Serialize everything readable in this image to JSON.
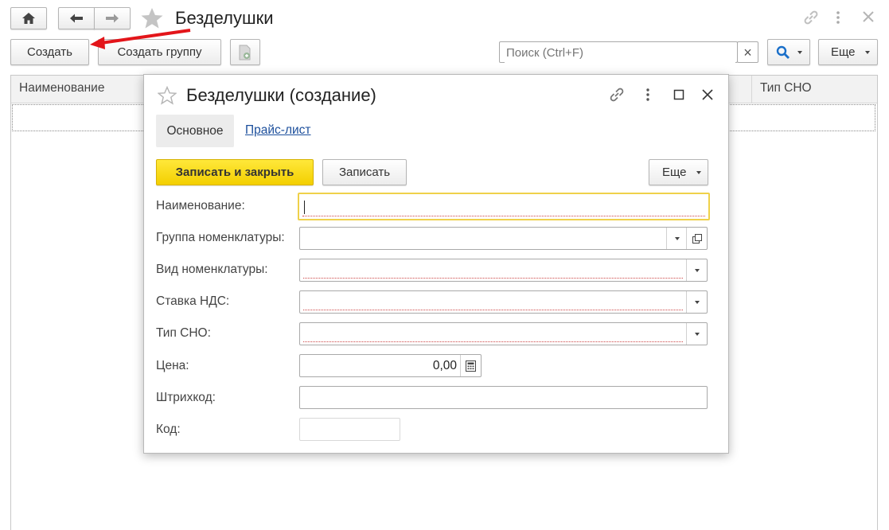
{
  "header": {
    "title": "Безделушки"
  },
  "toolbar": {
    "create_label": "Создать",
    "create_group_label": "Создать группу",
    "search_placeholder": "Поиск (Ctrl+F)",
    "clear_symbol": "×",
    "more_label": "Еще"
  },
  "list": {
    "col_name": "Наименование",
    "col_tax": "Тип СНО"
  },
  "dialog": {
    "title": "Безделушки (создание)",
    "tabs": [
      {
        "label": "Основное"
      },
      {
        "label": "Прайс-лист"
      }
    ],
    "save_close_label": "Записать и закрыть",
    "save_label": "Записать",
    "more_label": "Еще",
    "fields": {
      "name_label": "Наименование:",
      "group_label": "Группа номенклатуры:",
      "kind_label": "Вид номенклатуры:",
      "vat_label": "Ставка НДС:",
      "tax_label": "Тип СНО:",
      "price_label": "Цена:",
      "price_value": "0,00",
      "barcode_label": "Штрихкод:",
      "code_label": "Код:"
    }
  },
  "colors": {
    "accent_yellow": "#f5d300",
    "arrow_red": "#e3151a",
    "link_blue": "#1c4f9c"
  }
}
